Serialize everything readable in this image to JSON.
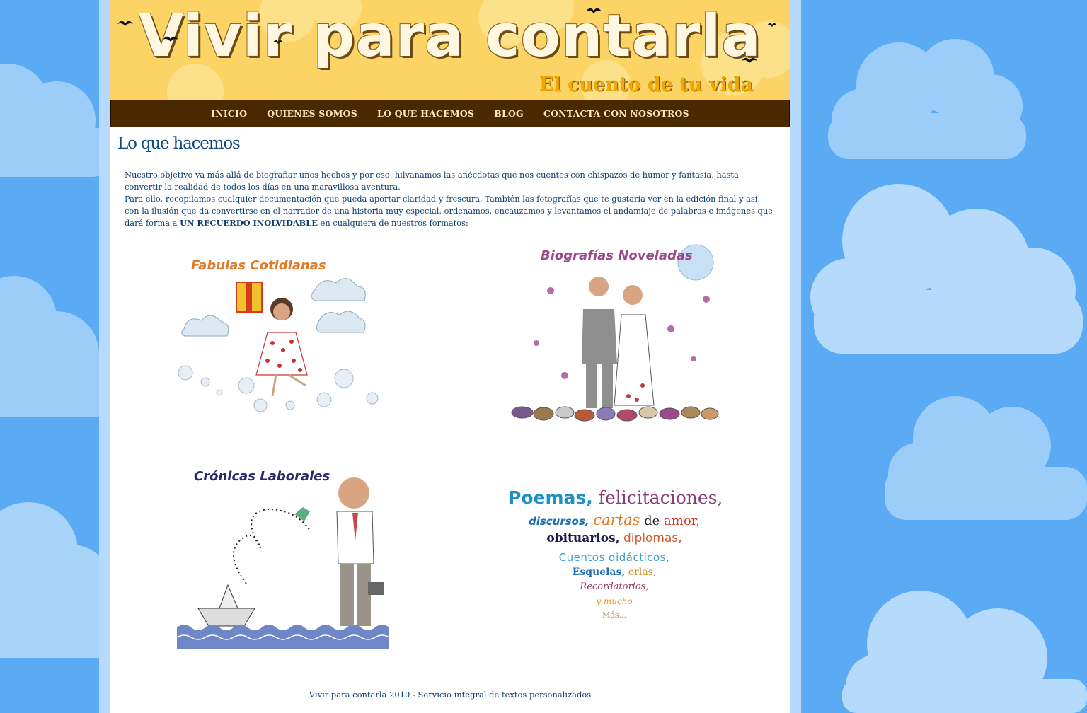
{
  "site": {
    "title": "Vivir para contarla",
    "subtitle": "El cuento de tu vida"
  },
  "nav": {
    "items": [
      "INICIO",
      "QUIENES SOMOS",
      "LO QUE HACEMOS",
      "BLOG",
      "CONTACTA CON NOSOTROS"
    ]
  },
  "page": {
    "title": "Lo que hacemos",
    "intro_1": "Nuestro objetivo va más allá de biografiar unos hechos y por eso, hilvanamos las anécdotas que nos cuentes con chispazos de humor y fantasía, hasta convertir la realidad de todos los días en una maravillosa aventura.",
    "intro_2_start": "Para ello, recopilamos cualquier documentación que pueda aportar claridad y frescura. También las fotografías que te gustaría ver en la edición final y así, con la ilusión que da convertirse en el narrador de una historia muy especial, ordenamos, encauzamos y levantamos el andamiaje de palabras e imágenes que dará forma a ",
    "intro_2_bold": "UN RECUERDO INOLVIDABLE",
    "intro_2_end": " en cualquiera de nuestros formatos:"
  },
  "formats": {
    "fabulas": "Fabulas Cotidianas",
    "biografias": "Biografías Noveladas",
    "cronicas": "Crónicas Laborales",
    "poemas": {
      "l1a": "Poemas,",
      "l1b": "felicitaciones,",
      "l2a": "discursos,",
      "l2b": "cartas",
      "l2c": "de",
      "l2d": "amor,",
      "l3a": "obituarios,",
      "l3b": "diplomas,",
      "l4": "Cuentos didácticos,",
      "l5a": "Esquelas,",
      "l5b": "orlas,",
      "l6": "Recordatorios,",
      "l7": "y mucho",
      "l8": "Más..."
    }
  },
  "footer": {
    "text": "Vivir para contarla 2010 - Servicio integral de textos personalizados"
  },
  "colors": {
    "sky": "#5aaaf4",
    "banner": "#fcd466",
    "nav": "#4a2800",
    "text": "#0f3e6e"
  }
}
